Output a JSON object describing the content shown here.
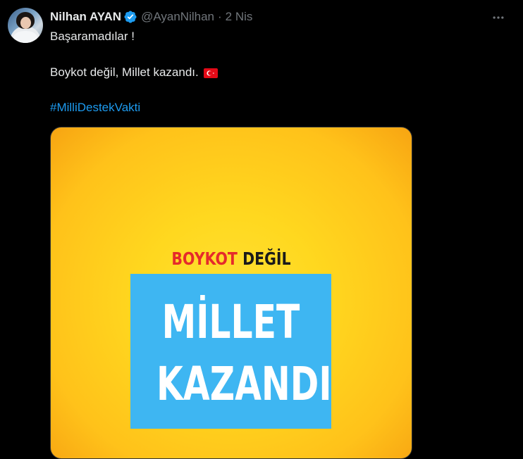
{
  "tweet": {
    "author_name": "Nilhan AYAN",
    "handle": "@AyanNilhan",
    "separator": "·",
    "date": "2 Nis",
    "line1": "Başaramadılar !",
    "line2": "Boykot değil, Millet kazandı.",
    "flag_emoji": "🇹🇷",
    "hashtag": "#MilliDestekVakti",
    "icons": {
      "verified": "verified-badge-icon",
      "more": "more-options-icon",
      "flag": "turkey-flag-icon"
    }
  },
  "media": {
    "poster_word_red": "BOYKOT",
    "poster_word_dark": "DEĞİL",
    "poster_line1": "MİLLET",
    "poster_line2": "KAZANDI"
  },
  "colors": {
    "background": "#000000",
    "text": "#e7e9ea",
    "muted": "#71767b",
    "link": "#1d9bf0",
    "verified": "#1d9bf0",
    "poster_yellow": "#ffd81f",
    "poster_blue": "#3eb6f2",
    "poster_red": "#e52b2b"
  }
}
